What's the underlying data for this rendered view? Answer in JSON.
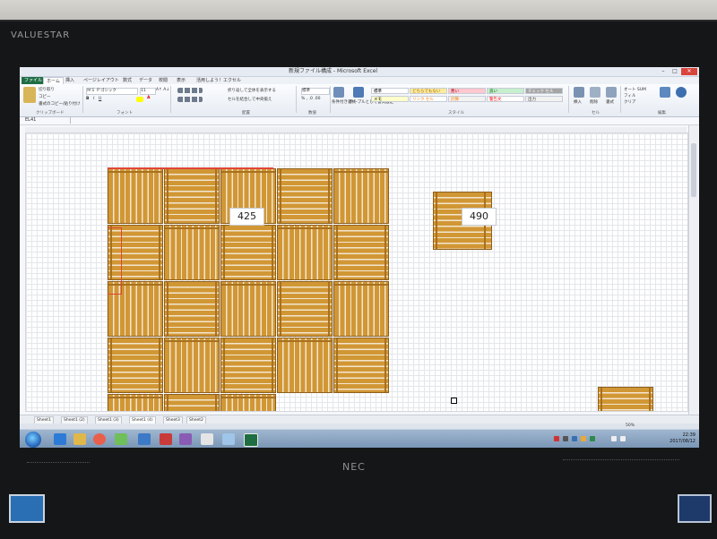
{
  "monitor": {
    "brand": "VALUESTAR",
    "vendor": "NEC"
  },
  "window": {
    "title": "新規ファイル構成 - Microsoft Excel",
    "controls": {
      "minimize": "–",
      "maximize": "□",
      "close": "✕"
    }
  },
  "ribbon_tabs": [
    "ファイル",
    "ホーム",
    "挿入",
    "ページレイアウト",
    "数式",
    "データ",
    "校閲",
    "表示",
    "活用しよう！エクセル"
  ],
  "ribbon": {
    "clipboard": {
      "cut": "切り取り",
      "copy": "コピー",
      "format_copy": "書式のコピー/貼り付け",
      "label": "クリップボード"
    },
    "font": {
      "name": "ＭＳ Ｐゴシック",
      "size": "11",
      "label": "フォント"
    },
    "alignment": {
      "wrap": "折り返して全体を表示する",
      "merge": "セルを結合して中央揃え",
      "label": "配置"
    },
    "number": {
      "format": "標準",
      "label": "数値"
    },
    "styles": {
      "conditional": "条件付き書式",
      "table": "テーブルとして書式設定",
      "cells": [
        {
          "text": "標準",
          "bg": "#ffffff",
          "fg": "#000000"
        },
        {
          "text": "どちらでもない",
          "bg": "#ffeb9c",
          "fg": "#9c6500"
        },
        {
          "text": "悪い",
          "bg": "#ffc7ce",
          "fg": "#9c0006"
        },
        {
          "text": "良い",
          "bg": "#c6efce",
          "fg": "#006100"
        },
        {
          "text": "チェック セル",
          "bg": "#a5a5a5",
          "fg": "#ffffff"
        },
        {
          "text": "メモ",
          "bg": "#ffffcc",
          "fg": "#000000"
        },
        {
          "text": "リンク セル",
          "bg": "#ffffff",
          "fg": "#fa7d00"
        },
        {
          "text": "計算",
          "bg": "#f2f2f2",
          "fg": "#fa7d00"
        },
        {
          "text": "警告文",
          "bg": "#ffffff",
          "fg": "#ff0000"
        },
        {
          "text": "出力",
          "bg": "#f2f2f2",
          "fg": "#3f3f3f"
        }
      ],
      "label": "スタイル"
    },
    "cells_group": {
      "insert": "挿入",
      "delete": "削除",
      "format": "書式",
      "label": "セル"
    },
    "editing": {
      "autosum": "オート SUM",
      "fill": "フィル",
      "clear": "クリア",
      "sort": "並べ替えとフィルター",
      "find": "検索と選択",
      "label": "編集"
    }
  },
  "name_box": "EL41",
  "sheet": {
    "labels": [
      "425",
      "490"
    ]
  },
  "sheet_tabs": [
    "Sheet1",
    "Sheet1 (2)",
    "Sheet1 (3)",
    "Sheet1 (4)",
    "Sheet3",
    "Sheet2"
  ],
  "zoom": "50%",
  "clock": {
    "time": "22:39",
    "date": "2017/08/12"
  },
  "colors": {
    "wood": "#cc8f2f",
    "plank_gap": "#f2e6cf",
    "file_tab": "#1f6e43",
    "selection": "#e0453a"
  }
}
